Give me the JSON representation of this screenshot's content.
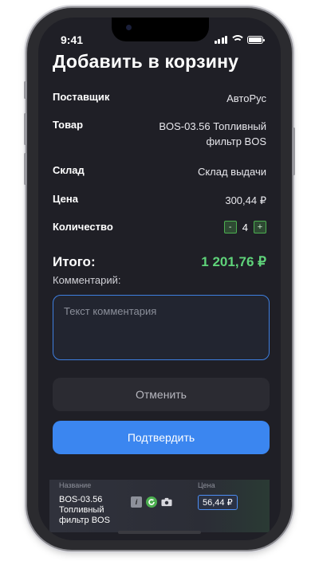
{
  "status": {
    "time": "9:41"
  },
  "title": "Добавить в корзину",
  "fields": {
    "supplier": {
      "label": "Поставщик",
      "value": "АвтоРус"
    },
    "product": {
      "label": "Товар",
      "value_line1": "BOS-03.56 Топливный",
      "value_line2": "фильтр BOS"
    },
    "warehouse": {
      "label": "Склад",
      "value": "Склад выдачи"
    },
    "price": {
      "label": "Цена",
      "value": "300,44 ₽"
    },
    "quantity": {
      "label": "Количество",
      "value": "4",
      "minus": "-",
      "plus": "+"
    }
  },
  "total": {
    "label": "Итого:",
    "value": "1 201,76 ₽",
    "color": "#5fd37a"
  },
  "comment": {
    "label": "Комментарий:",
    "placeholder": "Текст комментария"
  },
  "buttons": {
    "cancel": "Отменить",
    "confirm": "Подтвердить",
    "confirm_color": "#3b86f0"
  },
  "bottom_card": {
    "col_name": "Название",
    "col_price": "Цена",
    "name_lines": [
      "BOS-03.56",
      "Топливный",
      "фильтр BOS"
    ],
    "icons": [
      "info-icon",
      "sync-icon",
      "camera-icon"
    ],
    "info_glyph": "i",
    "price": "56,44 ₽"
  }
}
